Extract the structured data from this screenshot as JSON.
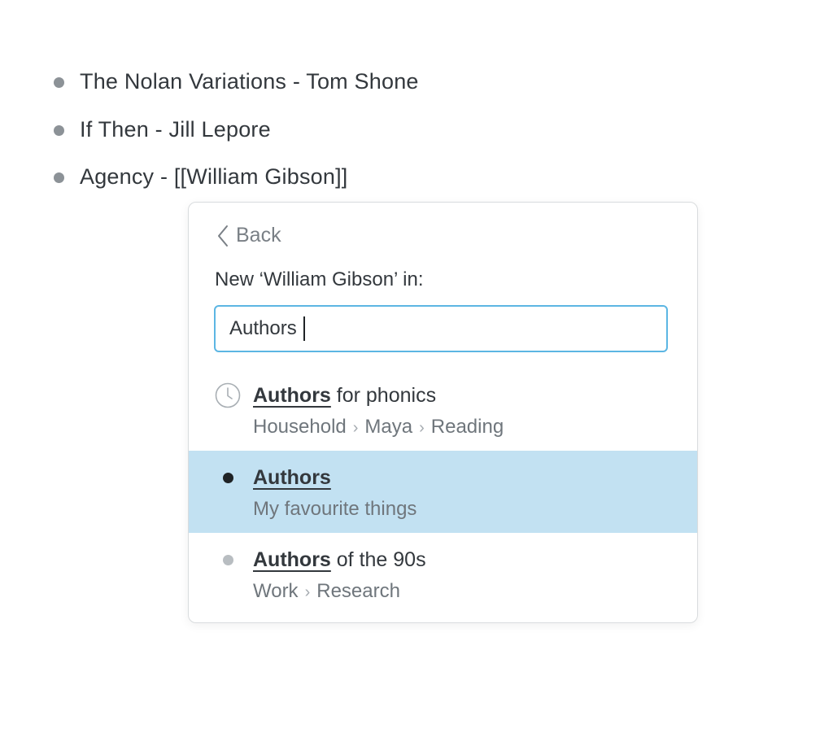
{
  "outline": {
    "items": [
      {
        "text": "The Nolan Variations - Tom Shone"
      },
      {
        "text": "If Then - Jill Lepore"
      },
      {
        "text": "Agency - [[William Gibson]]"
      }
    ]
  },
  "popup": {
    "back_label": "Back",
    "prompt": "New ‘William Gibson’ in:",
    "search_value": "Authors",
    "results": [
      {
        "icon": "clock-icon",
        "match": "Authors",
        "rest": " for phonics",
        "path": [
          "Household",
          "Maya",
          "Reading"
        ],
        "selected": false
      },
      {
        "icon": "bullet-dot-icon",
        "match": "Authors",
        "rest": "",
        "path": [
          "My favourite things"
        ],
        "selected": true
      },
      {
        "icon": "bullet-dot-icon",
        "match": "Authors",
        "rest": " of the 90s",
        "path": [
          "Work",
          "Research"
        ],
        "selected": false
      }
    ],
    "path_separator": "›"
  },
  "colors": {
    "selected_bg": "#c2e1f2",
    "input_border": "#5cb6e3",
    "text": "#33383d",
    "muted_text": "#6f767c",
    "outline_bullet": "#8c9297",
    "selected_dot": "#1f2326",
    "light_dot": "#b8bdc1"
  }
}
